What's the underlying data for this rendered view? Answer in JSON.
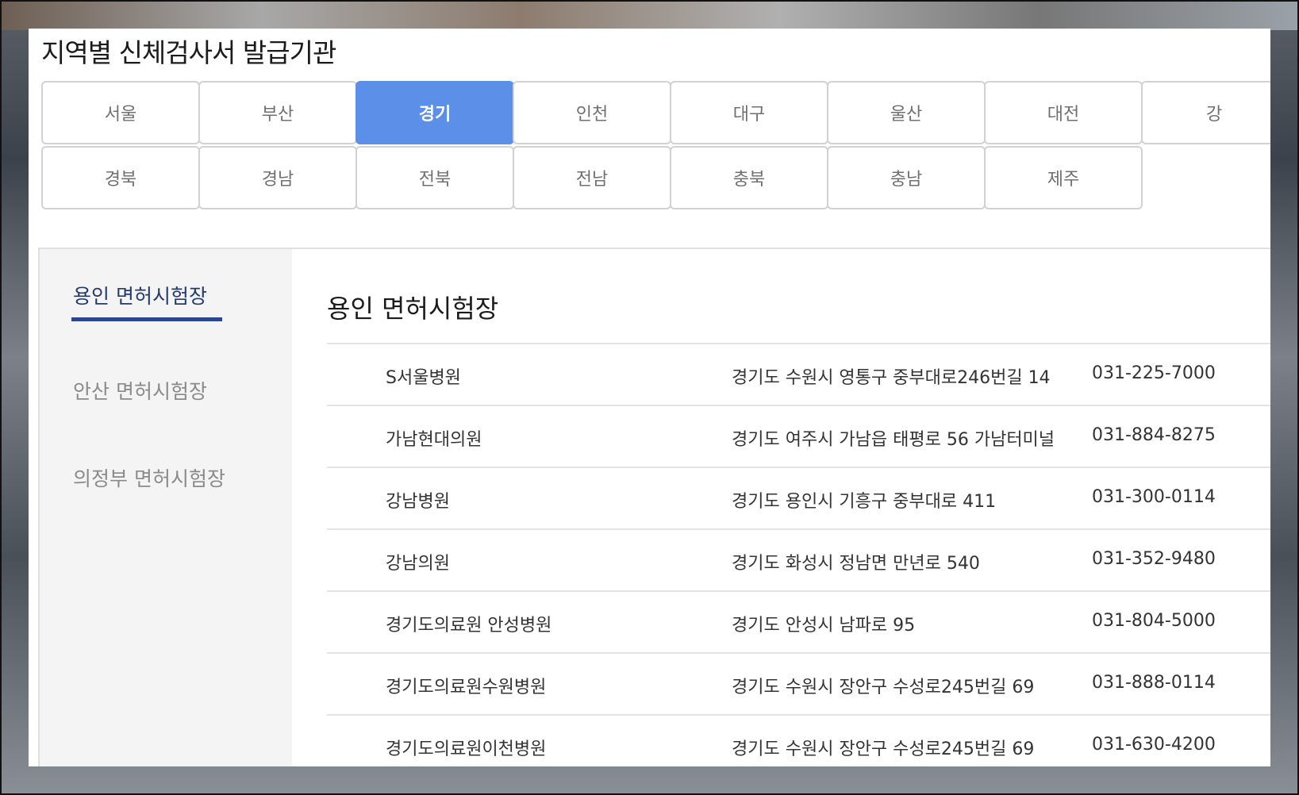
{
  "page": {
    "title": "지역별 신체검사서 발급기관"
  },
  "regions": {
    "row1": [
      "서울",
      "부산",
      "경기",
      "인천",
      "대구",
      "울산",
      "대전",
      "강"
    ],
    "row2": [
      "경북",
      "경남",
      "전북",
      "전남",
      "충북",
      "충남",
      "제주"
    ],
    "active": "경기"
  },
  "sidebar": {
    "items": [
      {
        "label": "용인 면허시험장",
        "active": true
      },
      {
        "label": "안산 면허시험장",
        "active": false
      },
      {
        "label": "의정부 면허시험장",
        "active": false
      }
    ]
  },
  "main": {
    "title": "용인 면허시험장",
    "rows": [
      {
        "name": "S서울병원",
        "address": "경기도 수원시 영통구 중부대로246번길 14",
        "phone": "031-225-7000"
      },
      {
        "name": "가남현대의원",
        "address": "경기도 여주시 가남읍 태평로 56 가남터미널",
        "phone": "031-884-8275"
      },
      {
        "name": "강남병원",
        "address": "경기도 용인시 기흥구 중부대로 411",
        "phone": "031-300-0114"
      },
      {
        "name": "강남의원",
        "address": "경기도 화성시 정남면 만년로 540",
        "phone": "031-352-9480"
      },
      {
        "name": "경기도의료원 안성병원",
        "address": "경기도 안성시 남파로 95",
        "phone": "031-804-5000"
      },
      {
        "name": "경기도의료원수원병원",
        "address": "경기도 수원시 장안구 수성로245번길 69",
        "phone": "031-888-0114"
      },
      {
        "name": "경기도의료원이천병원",
        "address": "경기도 수원시 장안구 수성로245번길 69",
        "phone": "031-630-4200"
      }
    ]
  },
  "colors": {
    "active_tab": "#5b8fe8",
    "sidebar_active_text": "#233a6e",
    "sidebar_underline": "#2b4590"
  }
}
